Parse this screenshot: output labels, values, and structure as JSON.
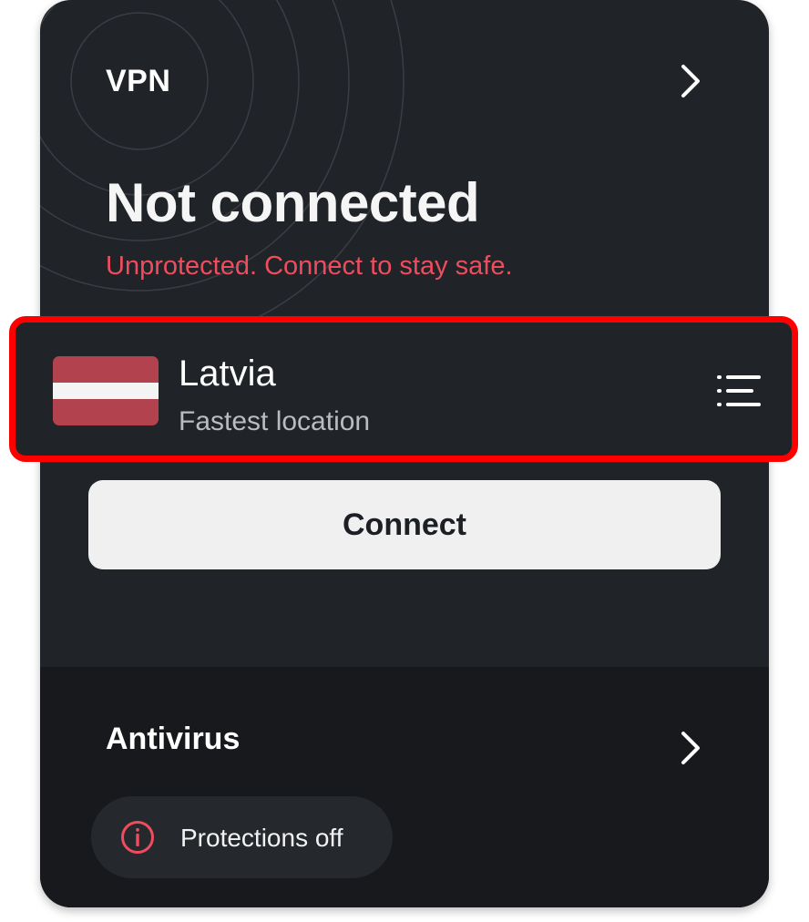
{
  "vpn": {
    "title": "VPN",
    "status": "Not connected",
    "status_message": "Unprotected. Connect to stay safe.",
    "location": {
      "name": "Latvia",
      "subtitle": "Fastest location",
      "flag_icon": "latvia-flag-icon"
    },
    "connect_label": "Connect"
  },
  "antivirus": {
    "title": "Antivirus",
    "status_label": "Protections off",
    "status_icon": "info-icon"
  },
  "colors": {
    "card_background": "#202327",
    "antivirus_background": "#17191c",
    "warning_red": "#ef4c5e",
    "highlight_border": "#ff0000",
    "button_background": "#f0f0f0"
  }
}
